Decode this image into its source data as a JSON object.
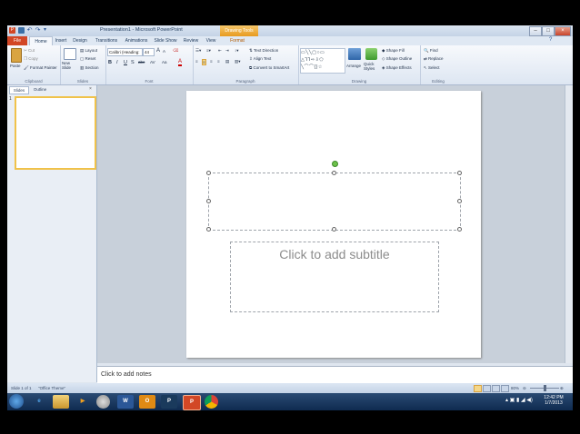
{
  "window": {
    "title": "Presentation1 - Microsoft PowerPoint",
    "contextual_tab": "Drawing Tools",
    "controls": [
      "–",
      "□",
      "×"
    ]
  },
  "tabs": [
    "File",
    "Home",
    "Insert",
    "Design",
    "Transitions",
    "Animations",
    "Slide Show",
    "Review",
    "View",
    "Format"
  ],
  "ribbon": {
    "clipboard": {
      "paste": "Paste",
      "cut": "Cut",
      "copy": "Copy",
      "format_painter": "Format Painter",
      "label": "Clipboard"
    },
    "slides": {
      "new_slide": "New Slide",
      "layout": "Layout",
      "reset": "Reset",
      "section": "Section",
      "label": "Slides"
    },
    "font": {
      "font_name": "Calibri (Heading:",
      "font_size": "44",
      "bold": "B",
      "italic": "I",
      "underline": "U",
      "strike": "S",
      "shadow": "abc",
      "spacing": "AV",
      "case": "Aa",
      "color": "A",
      "grow": "A",
      "shrink": "A",
      "label": "Font"
    },
    "paragraph": {
      "text_direction": "Text Direction",
      "align_text": "Align Text",
      "smartart": "Convert to SmartArt",
      "label": "Paragraph"
    },
    "drawing": {
      "arrange": "Arrange",
      "quick_styles": "Quick Styles",
      "shape_fill": "Shape Fill",
      "shape_outline": "Shape Outline",
      "shape_effects": "Shape Effects",
      "label": "Drawing"
    },
    "editing": {
      "find": "Find",
      "replace": "Replace",
      "select": "Select",
      "label": "Editing"
    }
  },
  "left_pane": {
    "tabs": [
      "Slides",
      "Outline"
    ],
    "slide_number": "1"
  },
  "slide": {
    "subtitle_placeholder": "Click to add subtitle"
  },
  "notes": {
    "placeholder": "Click to add notes"
  },
  "status": {
    "slide": "Slide 1 of 1",
    "theme": "\"Office Theme\"",
    "zoom": "80%"
  },
  "taskbar": {
    "time": "12:42 PM",
    "date": "1/7/2013",
    "apps": [
      "start",
      "internet-explorer",
      "file-explorer",
      "media-player",
      "chrome-circle",
      "word",
      "outlook",
      "publisher",
      "powerpoint",
      "chrome"
    ]
  },
  "colors": {
    "file_tab": "#d24726",
    "accent": "#2b5797",
    "tools_tab": "#e79a1f"
  }
}
